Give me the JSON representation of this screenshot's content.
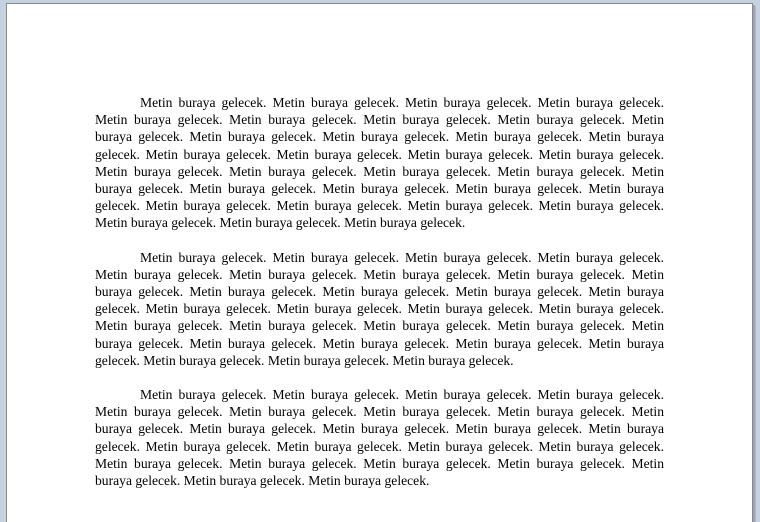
{
  "document": {
    "paragraphs": [
      {
        "text": "Metin buraya gelecek. Metin buraya gelecek. Metin buraya gelecek. Metin buraya gelecek. Metin buraya gelecek. Metin buraya gelecek. Metin buraya gelecek. Metin buraya gelecek. Metin buraya gelecek. Metin buraya gelecek. Metin buraya gelecek. Metin buraya gelecek. Metin buraya gelecek. Metin buraya gelecek. Metin buraya gelecek. Metin buraya gelecek. Metin buraya gelecek. Metin buraya gelecek. Metin buraya gelecek. Metin buraya gelecek. Metin buraya gelecek. Metin buraya gelecek. Metin buraya gelecek. Metin buraya gelecek. Metin buraya gelecek. Metin buraya gelecek. Metin buraya gelecek. Metin buraya gelecek. Metin buraya gelecek. Metin buraya gelecek. Metin buraya gelecek. Metin buraya gelecek. Metin buraya gelecek."
      },
      {
        "text": "Metin buraya gelecek. Metin buraya gelecek. Metin buraya gelecek. Metin buraya gelecek. Metin buraya gelecek. Metin buraya gelecek. Metin buraya gelecek. Metin buraya gelecek. Metin buraya gelecek. Metin buraya gelecek. Metin buraya gelecek. Metin buraya gelecek. Metin buraya gelecek. Metin buraya gelecek. Metin buraya gelecek. Metin buraya gelecek. Metin buraya gelecek. Metin buraya gelecek. Metin buraya gelecek. Metin buraya gelecek. Metin buraya gelecek. Metin buraya gelecek. Metin buraya gelecek. Metin buraya gelecek. Metin buraya gelecek. Metin buraya gelecek. Metin buraya gelecek. Metin buraya gelecek. Metin buraya gelecek."
      },
      {
        "text": "Metin buraya gelecek. Metin buraya gelecek. Metin buraya gelecek. Metin buraya gelecek. Metin buraya gelecek. Metin buraya gelecek. Metin buraya gelecek. Metin buraya gelecek. Metin buraya gelecek. Metin buraya gelecek. Metin buraya gelecek. Metin buraya gelecek. Metin buraya gelecek. Metin buraya gelecek. Metin buraya gelecek. Metin buraya gelecek. Metin buraya gelecek. Metin buraya gelecek. Metin buraya gelecek. Metin buraya gelecek. Metin buraya gelecek. Metin buraya gelecek. Metin buraya gelecek. Metin buraya gelecek."
      }
    ]
  },
  "colors": {
    "workspace_background": "#c6d2e2",
    "page_background": "#ffffff",
    "text": "#000000"
  }
}
